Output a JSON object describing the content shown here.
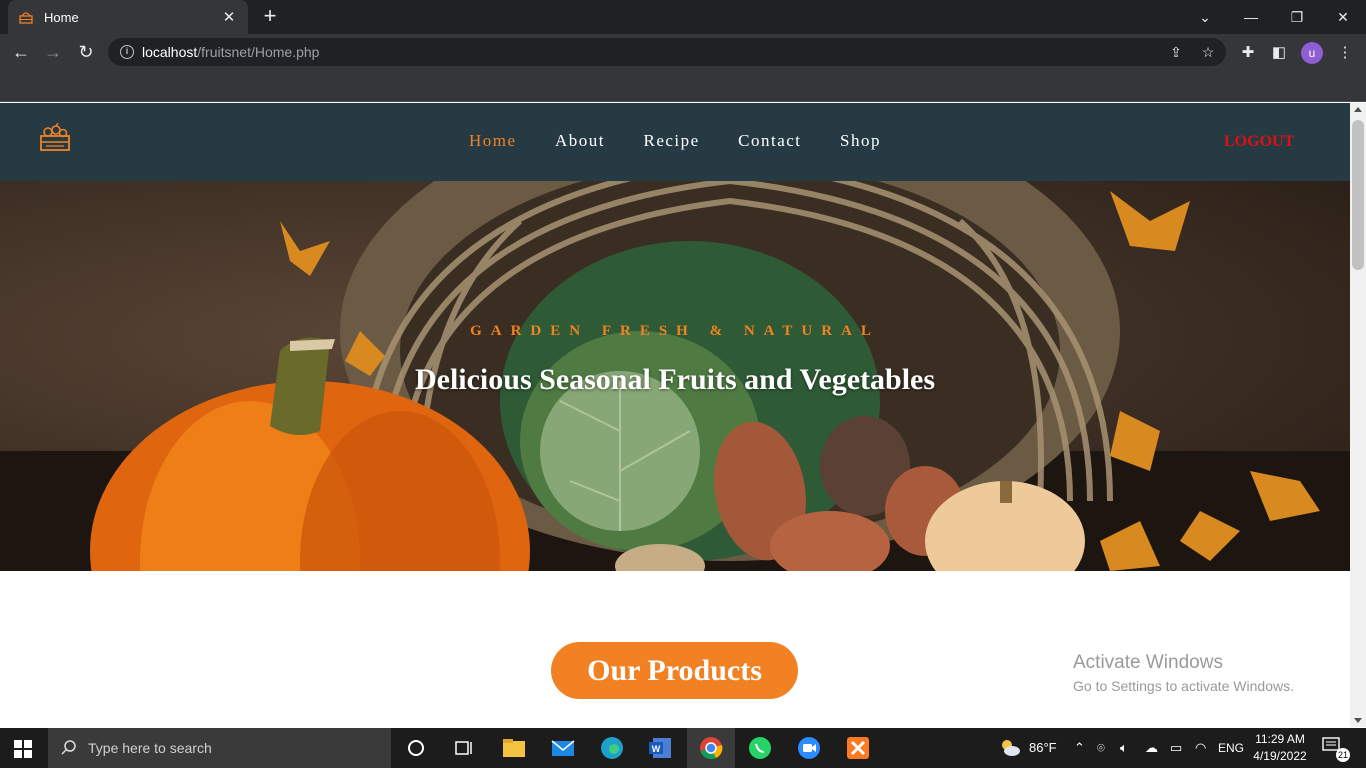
{
  "browser": {
    "tab_title": "Home",
    "url_host": "localhost",
    "url_path": "/fruitsnet/Home.php",
    "profile_initial": "u"
  },
  "site": {
    "nav": [
      {
        "label": "Home"
      },
      {
        "label": "About"
      },
      {
        "label": "Recipe"
      },
      {
        "label": "Contact"
      },
      {
        "label": "Shop"
      }
    ],
    "logout_label": "LOGOUT",
    "hero_subtitle": "GARDEN FRESH & NATURAL",
    "hero_title": "Delicious Seasonal Fruits and Vegetables",
    "products_button": "Our Products",
    "accent_color": "#f28123",
    "header_color": "#263a44"
  },
  "watermark": {
    "line1": "Activate Windows",
    "line2": "Go to Settings to activate Windows."
  },
  "taskbar": {
    "search_placeholder": "Type here to search",
    "weather": "86°F",
    "language": "ENG",
    "time": "11:29 AM",
    "date": "4/19/2022",
    "notifications": "21"
  }
}
